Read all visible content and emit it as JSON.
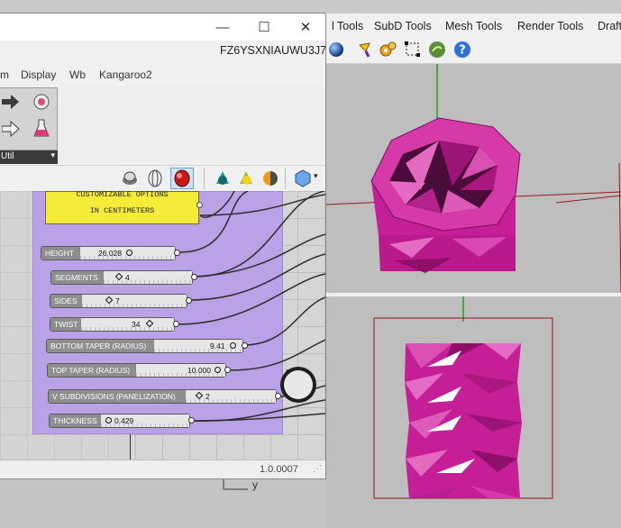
{
  "rhino": {
    "menu_items": [
      "l Tools",
      "SubD Tools",
      "Mesh Tools",
      "Render Tools",
      "Draft"
    ]
  },
  "grasshopper": {
    "window_controls": {
      "minimize": "—",
      "maximize": "☐",
      "close": "✕"
    },
    "document_name": "FZ6YSXNIAUWU3J7*",
    "menu_items": [
      "m",
      "Display",
      "Wb",
      "Kangaroo2"
    ],
    "ribbon_group": "Util",
    "canvas_title_lines": [
      "CUSTOMIZABLE OPTIONS",
      "IN CENTIMETERS"
    ],
    "sliders": [
      {
        "label": "HEIGHT",
        "value": "26.028"
      },
      {
        "label": "SEGMENTS",
        "value": "4"
      },
      {
        "label": "SIDES",
        "value": "7"
      },
      {
        "label": "TWIST",
        "value": "34"
      },
      {
        "label": "BOTTOM TAPER (RADIUS)",
        "value": "9.41"
      },
      {
        "label": "TOP TAPER (RADIUS)",
        "value": "10.000"
      },
      {
        "label": "V SUBDIVISIONS (PANELIZATION)",
        "value": "2"
      },
      {
        "label": "THICKNESS",
        "value": "0.429"
      }
    ],
    "version": "1.0.0007"
  },
  "viewport": {
    "axis_label": "y"
  },
  "colors": {
    "group_purple": "#b9a2e6",
    "panel_yellow": "#f5ec3a",
    "mesh_magenta": "#c41f96",
    "bounding_box_red": "#8b1a1a"
  }
}
